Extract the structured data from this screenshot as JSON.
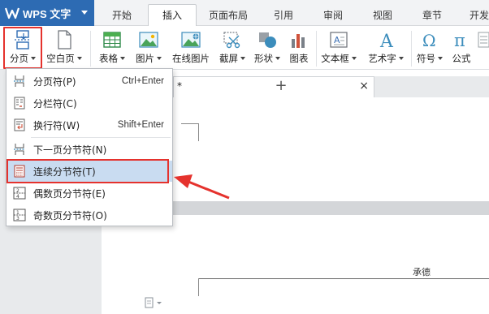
{
  "app": {
    "name": "WPS 文字"
  },
  "tabs": [
    {
      "label": "开始",
      "active": false
    },
    {
      "label": "插入",
      "active": true
    },
    {
      "label": "页面布局",
      "active": false
    },
    {
      "label": "引用",
      "active": false
    },
    {
      "label": "审阅",
      "active": false
    },
    {
      "label": "视图",
      "active": false
    },
    {
      "label": "章节",
      "active": false
    },
    {
      "label": "开发",
      "active": false
    }
  ],
  "ribbon": {
    "page_break": "分页",
    "blank_page": "空白页",
    "table": "表格",
    "picture": "图片",
    "online_picture": "在线图片",
    "screenshot": "截屏",
    "shape": "形状",
    "chart": "图表",
    "textbox": "文本框",
    "wordart": "艺术字",
    "symbol": "符号",
    "formula": "公式"
  },
  "menu": {
    "items": [
      {
        "label": "分页符(P)",
        "shortcut": "Ctrl+Enter",
        "icon": "page-break-icon"
      },
      {
        "label": "分栏符(C)",
        "shortcut": "",
        "icon": "column-break-icon"
      },
      {
        "label": "换行符(W)",
        "shortcut": "Shift+Enter",
        "icon": "line-break-icon"
      },
      {
        "label": "下一页分节符(N)",
        "shortcut": "",
        "icon": "next-page-section-icon"
      },
      {
        "label": "连续分节符(T)",
        "shortcut": "",
        "icon": "continuous-section-icon",
        "selected": true
      },
      {
        "label": "偶数页分节符(E)",
        "shortcut": "",
        "icon": "even-page-section-icon"
      },
      {
        "label": "奇数页分节符(O)",
        "shortcut": "",
        "icon": "odd-page-section-icon"
      }
    ]
  },
  "doc": {
    "tab_title": "*",
    "close": "×",
    "new_tab": "+",
    "header_text": "承德"
  },
  "colors": {
    "accent": "#2d6bb3",
    "highlight": "#e5322d",
    "selected": "#c9dcf1"
  }
}
